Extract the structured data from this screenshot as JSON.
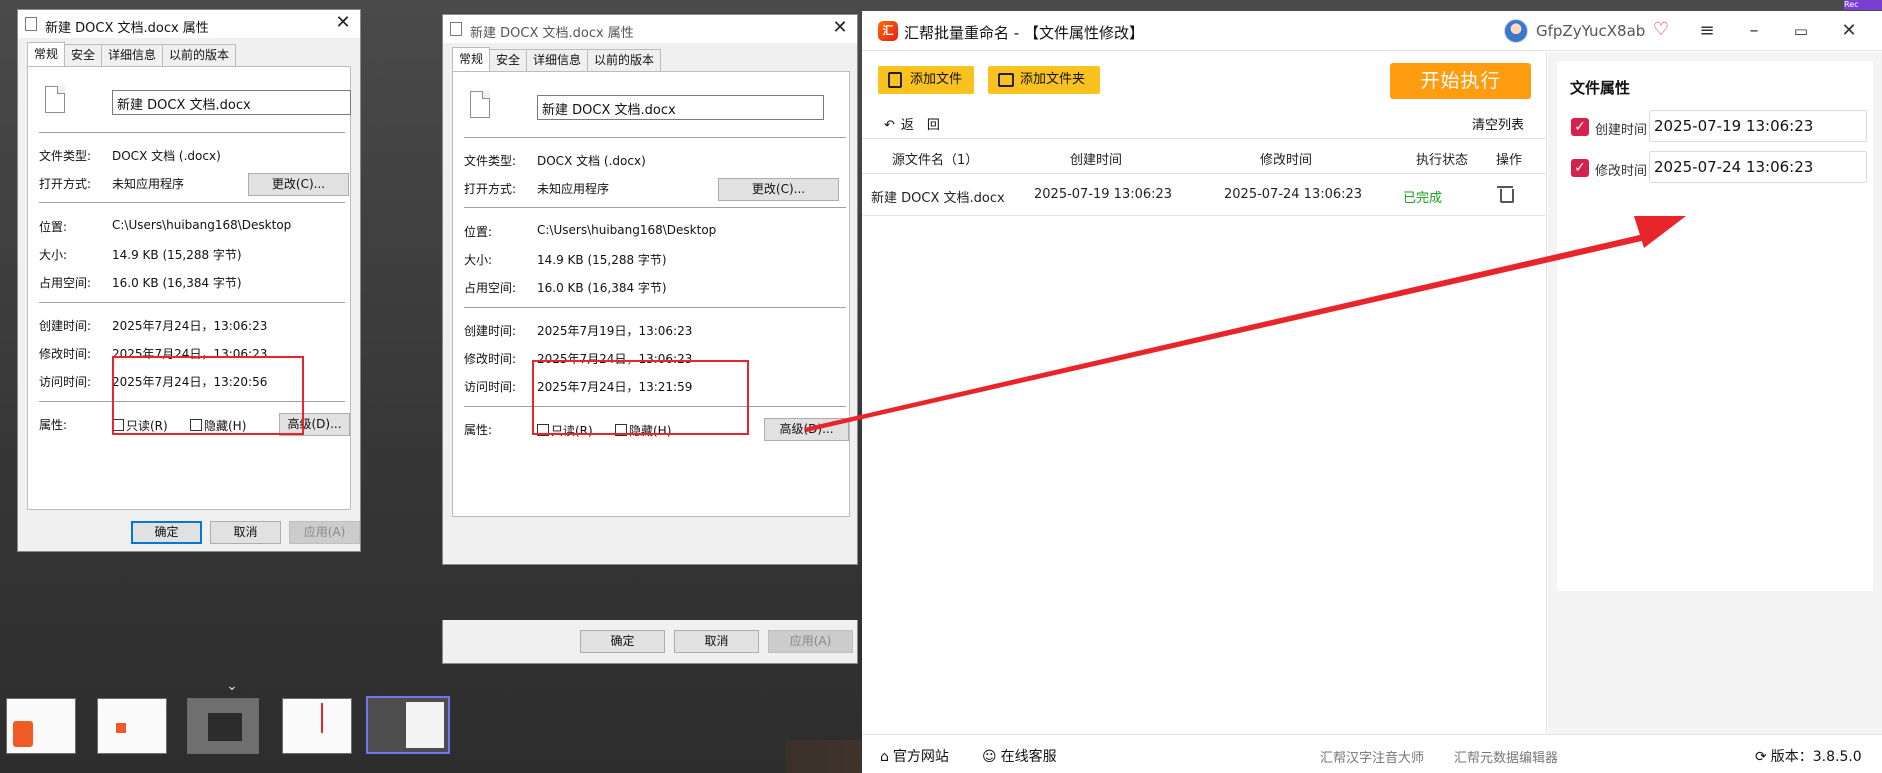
{
  "dialog1": {
    "title": "新建 DOCX 文档.docx 属性",
    "tabs": [
      "常规",
      "安全",
      "详细信息",
      "以前的版本"
    ],
    "filename": "新建 DOCX 文档.docx",
    "rows": {
      "type_label": "文件类型:",
      "type_value": "DOCX 文档 (.docx)",
      "open_label": "打开方式:",
      "open_value": "未知应用程序",
      "change_btn": "更改(C)...",
      "location_label": "位置:",
      "location_value": "C:\\Users\\huibang168\\Desktop",
      "size_label": "大小:",
      "size_value": "14.9 KB (15,288 字节)",
      "disk_label": "占用空间:",
      "disk_value": "16.0 KB (16,384 字节)",
      "created_label": "创建时间:",
      "created_value": "2025年7月24日，13:06:23",
      "modified_label": "修改时间:",
      "modified_value": "2025年7月24日，13:06:23",
      "accessed_label": "访问时间:",
      "accessed_value": "2025年7月24日，13:20:56",
      "attr_label": "属性:",
      "readonly": "只读(R)",
      "hidden": "隐藏(H)",
      "advanced_btn": "高级(D)..."
    },
    "ok": "确定",
    "cancel": "取消",
    "apply": "应用(A)"
  },
  "dialog2": {
    "title": "新建 DOCX 文档.docx 属性",
    "tabs": [
      "常规",
      "安全",
      "详细信息",
      "以前的版本"
    ],
    "filename": "新建 DOCX 文档.docx",
    "rows": {
      "type_label": "文件类型:",
      "type_value": "DOCX 文档 (.docx)",
      "open_label": "打开方式:",
      "open_value": "未知应用程序",
      "change_btn": "更改(C)...",
      "location_label": "位置:",
      "location_value": "C:\\Users\\huibang168\\Desktop",
      "size_label": "大小:",
      "size_value": "14.9 KB (15,288 字节)",
      "disk_label": "占用空间:",
      "disk_value": "16.0 KB (16,384 字节)",
      "created_label": "创建时间:",
      "created_value": "2025年7月19日，13:06:23",
      "modified_label": "修改时间:",
      "modified_value": "2025年7月24日，13:06:23",
      "accessed_label": "访问时间:",
      "accessed_value": "2025年7月24日，13:21:59",
      "attr_label": "属性:",
      "readonly": "只读(R)",
      "hidden": "隐藏(H)",
      "advanced_btn": "高级(D)..."
    },
    "ok": "确定",
    "cancel": "取消",
    "apply": "应用(A)"
  },
  "app": {
    "title": "汇帮批量重命名 - 【文件属性修改】",
    "username": "GfpZyYucX8ab",
    "add_file": "添加文件",
    "add_folder": "添加文件夹",
    "start": "开始执行",
    "back": "返　回",
    "clear_list": "清空列表",
    "columns": [
      "源文件名（1）",
      "创建时间",
      "修改时间",
      "执行状态",
      "操作"
    ],
    "rows": [
      {
        "name": "新建 DOCX 文档.docx",
        "created": "2025-07-19 13:06:23",
        "modified": "2025-07-24 13:06:23",
        "status": "已完成"
      }
    ],
    "attr_panel": {
      "title": "文件属性",
      "created_label": "创建时间",
      "created_value": "2025-07-19 13:06:23",
      "modified_label": "修改时间",
      "modified_value": "2025-07-24 13:06:23"
    },
    "footer": {
      "website": "官方网站",
      "support": "在线客服",
      "link1": "汇帮汉字注音大师",
      "link2": "汇帮元数据编辑器",
      "version": "版本：3.8.5.0"
    },
    "colors": {
      "accent_yellow": "#f9c21f",
      "start_orange": "#ff9c0f",
      "check_red": "#d6204e",
      "done_green": "#19a319",
      "annotation_red": "#e8252b"
    }
  },
  "corner_tag": "Rec"
}
